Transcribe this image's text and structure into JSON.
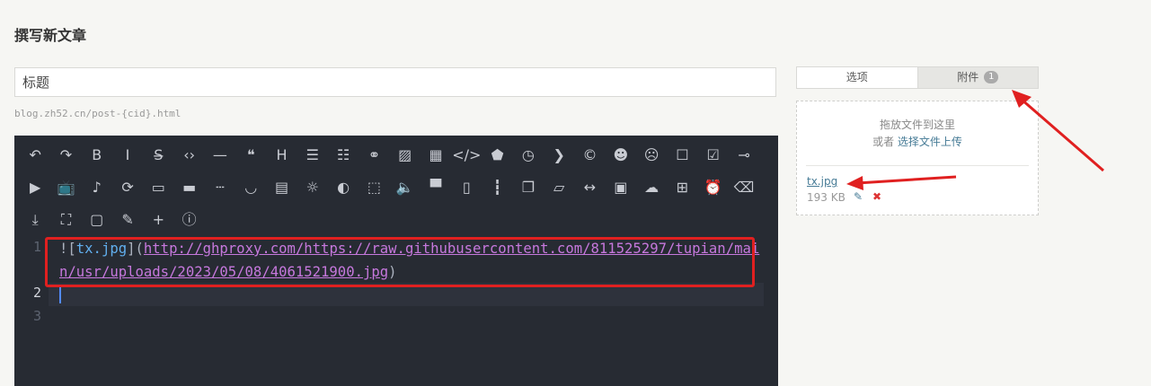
{
  "page": {
    "title": "撰写新文章"
  },
  "post": {
    "title_placeholder": "标题",
    "permalink": "blog.zh52.cn/post-{cid}.html"
  },
  "editor": {
    "toolbar_rows": [
      [
        {
          "name": "undo-icon",
          "glyph": "↶"
        },
        {
          "name": "redo-icon",
          "glyph": "↷"
        },
        {
          "name": "bold-icon",
          "glyph": "B"
        },
        {
          "name": "italic-icon",
          "glyph": "I"
        },
        {
          "name": "strikethrough-icon",
          "glyph": "S̶"
        },
        {
          "name": "inline-code-icon",
          "glyph": "‹›"
        },
        {
          "name": "horizontal-rule-icon",
          "glyph": "—"
        },
        {
          "name": "quote-icon",
          "glyph": "❝"
        },
        {
          "name": "heading-icon",
          "glyph": "H"
        },
        {
          "name": "ordered-list-icon",
          "glyph": "☰"
        },
        {
          "name": "unordered-list-icon",
          "glyph": "☷"
        },
        {
          "name": "link-icon",
          "glyph": "⚭"
        },
        {
          "name": "image-icon",
          "glyph": "▨"
        },
        {
          "name": "table-icon",
          "glyph": "▦"
        },
        {
          "name": "code-block-icon",
          "glyph": "</>"
        },
        {
          "name": "html5-icon",
          "glyph": "⬟"
        },
        {
          "name": "clock-icon",
          "glyph": "◷"
        },
        {
          "name": "next-icon",
          "glyph": "❯"
        },
        {
          "name": "copyright-icon",
          "glyph": "©"
        },
        {
          "name": "smile-icon",
          "glyph": "☻"
        },
        {
          "name": "sad-icon",
          "glyph": "☹"
        },
        {
          "name": "checkbox-empty-icon",
          "glyph": "☐"
        },
        {
          "name": "checkbox-checked-icon",
          "glyph": "☑"
        },
        {
          "name": "commit-icon",
          "glyph": "⊸"
        }
      ],
      [
        {
          "name": "video-icon",
          "glyph": "▶"
        },
        {
          "name": "tv-icon",
          "glyph": "📺"
        },
        {
          "name": "music-icon",
          "glyph": "♪"
        },
        {
          "name": "sync-icon",
          "glyph": "⟳"
        },
        {
          "name": "btn-icon",
          "glyph": "▭"
        },
        {
          "name": "button-icon",
          "glyph": "▬"
        },
        {
          "name": "dashed-line-icon",
          "glyph": "┄"
        },
        {
          "name": "eye-closed-icon",
          "glyph": "◡"
        },
        {
          "name": "card-icon",
          "glyph": "▤"
        },
        {
          "name": "bulb-icon",
          "glyph": "☼"
        },
        {
          "name": "toggle-icon",
          "glyph": "◐"
        },
        {
          "name": "dotted-box-icon",
          "glyph": "⬚"
        },
        {
          "name": "volume-icon",
          "glyph": "🔈"
        },
        {
          "name": "layout-icon",
          "glyph": "▀"
        },
        {
          "name": "document-icon",
          "glyph": "▯"
        },
        {
          "name": "timeline-icon",
          "glyph": "┇"
        },
        {
          "name": "copy-icon",
          "glyph": "❐"
        },
        {
          "name": "folder-icon",
          "glyph": "▱"
        },
        {
          "name": "arrow-both-icon",
          "glyph": "↔"
        },
        {
          "name": "window-icon",
          "glyph": "▣"
        },
        {
          "name": "cloud-icon",
          "glyph": "☁"
        },
        {
          "name": "grid-icon",
          "glyph": "⊞"
        },
        {
          "name": "alarm-icon",
          "glyph": "⏰"
        },
        {
          "name": "eraser-icon",
          "glyph": "⌫"
        }
      ],
      [
        {
          "name": "download-icon",
          "glyph": "⤓"
        },
        {
          "name": "fullscreen-icon",
          "glyph": "⛶"
        },
        {
          "name": "wallet-icon",
          "glyph": "▢"
        },
        {
          "name": "pencil-icon",
          "glyph": "✎"
        },
        {
          "name": "plus-icon",
          "glyph": "+"
        },
        {
          "name": "info-icon",
          "glyph": "ⓘ"
        }
      ]
    ],
    "line_numbers": [
      "1",
      "2",
      "3"
    ],
    "line1": {
      "prefix": "![",
      "alt": "tx.jpg",
      "mid": "](",
      "url": "http://ghproxy.com/https://raw.githubusercontent.com/811525297/tupian/main/usr/uploads/2023/05/08/4061521900.jpg",
      "suffix": ")"
    }
  },
  "sidebar": {
    "tabs": {
      "options": "选项",
      "attachments": "附件",
      "attachments_count": "1"
    },
    "upload": {
      "drag_hint": "拖放文件到这里",
      "or": "或者",
      "choose_link": "选择文件上传"
    },
    "file": {
      "name": "tx.jpg",
      "size": "193 KB",
      "edit_icon": "pencil-icon",
      "delete_icon": "close-icon"
    }
  },
  "colors": {
    "accent": "#467b96",
    "annotation": "#e02020",
    "editor_bg": "#272b33"
  }
}
